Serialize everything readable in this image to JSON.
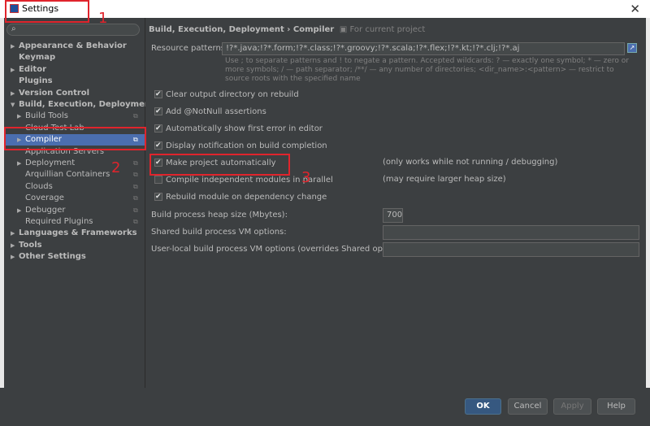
{
  "window": {
    "title": "Settings",
    "close_glyph": "✕"
  },
  "search": {
    "placeholder": "",
    "icon": "search-icon"
  },
  "tree": [
    {
      "label": "Appearance & Behavior",
      "arrow": "▶",
      "bold": true
    },
    {
      "label": "Keymap",
      "arrow": "",
      "bold": true
    },
    {
      "label": "Editor",
      "arrow": "▶",
      "bold": true
    },
    {
      "label": "Plugins",
      "arrow": "",
      "bold": true
    },
    {
      "label": "Version Control",
      "arrow": "▶",
      "bold": true
    },
    {
      "label": "Build, Execution, Deployment",
      "arrow": "▼",
      "bold": true
    },
    {
      "label": "Build Tools",
      "arrow": "▶",
      "bold": false
    },
    {
      "label": "Cloud Test Lab",
      "arrow": "",
      "bold": false
    },
    {
      "label": "Compiler",
      "arrow": "▶",
      "bold": false,
      "selected": true
    },
    {
      "label": "Application Servers",
      "arrow": "",
      "bold": false
    },
    {
      "label": "Deployment",
      "arrow": "▶",
      "bold": false
    },
    {
      "label": "Arquillian Containers",
      "arrow": "",
      "bold": false
    },
    {
      "label": "Clouds",
      "arrow": "",
      "bold": false
    },
    {
      "label": "Coverage",
      "arrow": "",
      "bold": false
    },
    {
      "label": "Debugger",
      "arrow": "▶",
      "bold": false
    },
    {
      "label": "Required Plugins",
      "arrow": "",
      "bold": false
    },
    {
      "label": "Languages & Frameworks",
      "arrow": "▶",
      "bold": true
    },
    {
      "label": "Tools",
      "arrow": "▶",
      "bold": true
    },
    {
      "label": "Other Settings",
      "arrow": "▶",
      "bold": true
    }
  ],
  "breadcrumb": {
    "path": "Build, Execution, Deployment › Compiler",
    "hint": "For current project"
  },
  "resource": {
    "label": "Resource patterns:",
    "value": "!?*.java;!?*.form;!?*.class;!?*.groovy;!?*.scala;!?*.flex;!?*.kt;!?*.clj;!?*.aj",
    "hint": "Use ; to separate patterns and ! to negate a pattern. Accepted wildcards: ? — exactly one symbol; * — zero or more symbols; / — path separator; /**/ — any number of directories; <dir_name>:<pattern> — restrict to source roots with the specified name"
  },
  "checkboxes": [
    {
      "label": "Clear output directory on rebuild",
      "checked": true,
      "note": ""
    },
    {
      "label": "Add @NotNull assertions",
      "checked": true,
      "note": ""
    },
    {
      "label": "Automatically show first error in editor",
      "checked": true,
      "note": ""
    },
    {
      "label": "Display notification on build completion",
      "checked": true,
      "note": ""
    },
    {
      "label": "Make project automatically",
      "checked": true,
      "note": "(only works while not running / debugging)"
    },
    {
      "label": "Compile independent modules in parallel",
      "checked": false,
      "note": "(may require larger heap size)"
    },
    {
      "label": "Rebuild module on dependency change",
      "checked": true,
      "note": ""
    }
  ],
  "heap": {
    "label": "Build process heap size (Mbytes):",
    "value": "700"
  },
  "shared_vm": {
    "label": "Shared build process VM options:",
    "value": ""
  },
  "user_vm": {
    "label": "User-local build process VM options (overrides Shared options):",
    "value": ""
  },
  "buttons": {
    "ok": "OK",
    "cancel": "Cancel",
    "apply": "Apply",
    "help": "Help"
  },
  "annotations": {
    "one": "1",
    "two": "2",
    "three": "3"
  },
  "colors": {
    "selection": "#4b6eaf",
    "annotation": "#e0242c",
    "ok_button": "#365880"
  }
}
